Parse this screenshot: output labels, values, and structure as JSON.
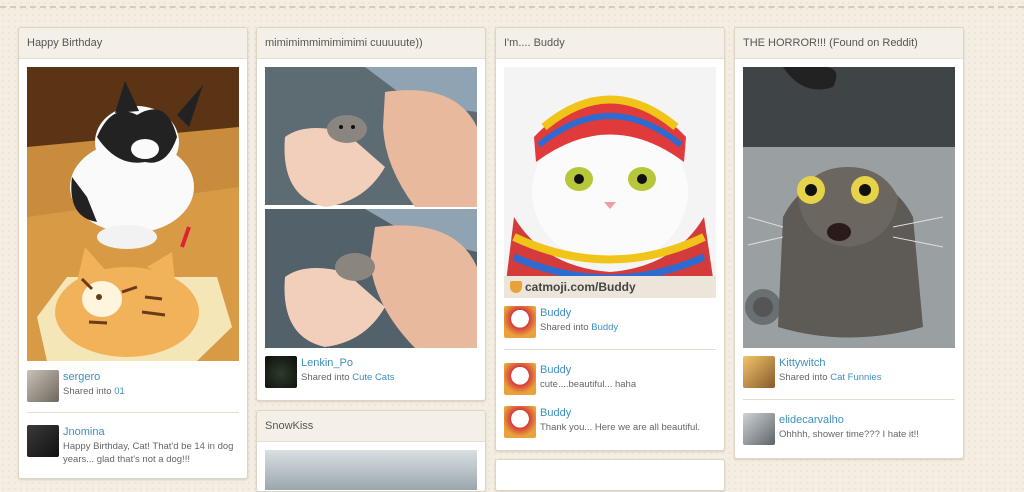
{
  "pins": [
    {
      "title": "Happy Birthday",
      "comments": [
        {
          "user": "sergero",
          "text_prefix": "Shared into ",
          "board": "01"
        },
        {
          "user": "Jnomina",
          "text": "Happy Birthday, Cat! That'd be 14 in dog years... glad that's not a dog!!!"
        }
      ]
    },
    {
      "title": "mimimimmimimimimi cuuuuute))",
      "comments": [
        {
          "user": "Lenkin_Po",
          "text_prefix": "Shared into ",
          "board": "Cute Cats"
        }
      ]
    },
    {
      "title": "I'm.... Buddy",
      "watermark": "catmoji.com/Buddy",
      "comments": [
        {
          "user": "Buddy",
          "text_prefix": "Shared into ",
          "board": "Buddy"
        },
        {
          "user": "Buddy",
          "text": "cute....beautiful... haha"
        },
        {
          "user": "Buddy",
          "text": "Thank you... Here we are all beautiful."
        }
      ]
    },
    {
      "title": "THE HORROR!!! (Found on Reddit)",
      "comments": [
        {
          "user": "Kittywitch",
          "text_prefix": "Shared into ",
          "board": "Cat Funnies"
        },
        {
          "user": "elidecarvalho",
          "text": "Ohhhh, shower time??? I hate it!!"
        }
      ]
    },
    {
      "title": "SnowKiss"
    }
  ]
}
